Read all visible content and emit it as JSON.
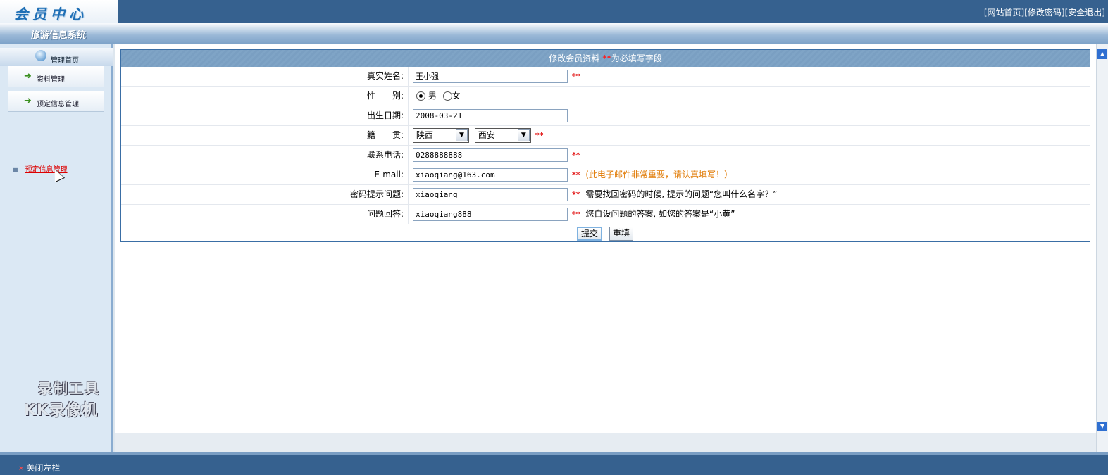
{
  "header": {
    "logo": "会员中心",
    "links": [
      "[网站首页]",
      "[修改密码]",
      "[安全退出]"
    ]
  },
  "subheader": {
    "system_title": "旅游信息系统"
  },
  "sidebar": {
    "home_label": "管理首页",
    "items": [
      {
        "label": "资料管理",
        "icon": "green-arrow-icon"
      },
      {
        "label": "预定信息管理",
        "icon": "green-arrow-icon"
      }
    ],
    "sub_link": "预定信息管理"
  },
  "watermark": {
    "line1": "录制工具",
    "line2": "KK录像机"
  },
  "form": {
    "title": "修改会员资料",
    "title_req_mark": "**",
    "title_req_text": "为必填写字段",
    "fields": {
      "realname": {
        "label": "真实姓名:",
        "value": "王小强",
        "star": "**"
      },
      "gender": {
        "label": "性　　别:",
        "options": [
          "男",
          "女"
        ],
        "selected": "男"
      },
      "birthday": {
        "label": "出生日期:",
        "value": "2008-03-21"
      },
      "native": {
        "label": "籍　　贯:",
        "province": "陕西",
        "city": "西安",
        "star": "**"
      },
      "phone": {
        "label": "联系电话:",
        "value": "0288888888",
        "star": "**"
      },
      "email": {
        "label": "E-mail:",
        "value": "xiaoqiang@163.com",
        "star": "**",
        "hint_pre": "(此",
        "hint_orange": "电子邮件非常重要，请认真填写！",
        "hint_post": "）"
      },
      "pwd_question": {
        "label": "密码提示问题:",
        "value": "xiaoqiang",
        "star": "**",
        "hint": "需要找回密码的时候, 提示的问题“您叫什么名字？”"
      },
      "pwd_answer": {
        "label": "问题回答:",
        "value": "xiaoqiang888",
        "star": "**",
        "hint": "您自设问题的答案, 如您的答案是“小黄”"
      }
    },
    "buttons": {
      "submit": "提交",
      "reset": "重填"
    }
  },
  "footer": {
    "close_sidebar": "关闭左栏",
    "close_icon": "close-icon"
  },
  "colors": {
    "bar_blue": "#36618f",
    "form_header": "#7fa4c6",
    "required_red": "#e31a1a",
    "hint_orange": "#e07800"
  }
}
